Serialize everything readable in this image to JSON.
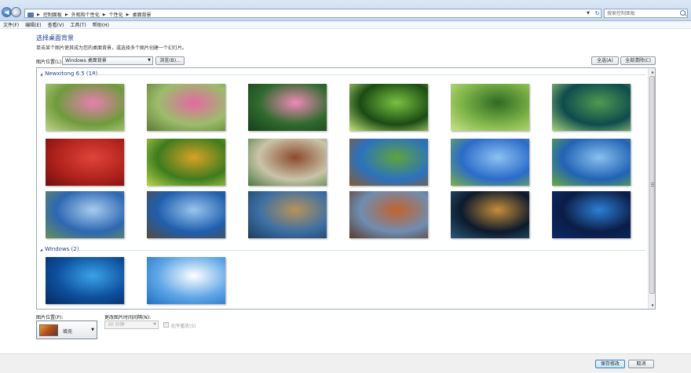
{
  "nav": {
    "back_glyph": "◀",
    "forward_glyph": "▶"
  },
  "address": {
    "crumbs": [
      "控制面板",
      "外观和个性化",
      "个性化",
      "桌面背景"
    ]
  },
  "search": {
    "placeholder": "搜索控制面板"
  },
  "menu": [
    "文件(F)",
    "编辑(E)",
    "查看(V)",
    "工具(T)",
    "帮助(H)"
  ],
  "page": {
    "title": "选择桌面背景",
    "description": "单击某个图片使其成为您的桌面背景，或选择多个图片创建一个幻灯片。",
    "location_label": "图片位置(L):",
    "location_value": "Windows 桌面背景",
    "browse_label": "浏览(B)...",
    "select_all_label": "全选(A)",
    "clear_all_label": "全部清除(C)"
  },
  "groups": [
    {
      "title": "Newxitong 6.5 (18)"
    },
    {
      "title": "Windows (2)"
    }
  ],
  "thumbnails": [
    [
      "#6f9b3c",
      "#e77fb1",
      "#c0d48a"
    ],
    [
      "#9bbd6a",
      "#e46aa3",
      "#5d7a36"
    ],
    [
      "#2f6a2d",
      "#f089b8",
      "#163e1c"
    ],
    [
      "#1a4b13",
      "#7ac142",
      "#c8e57f"
    ],
    [
      "#7fb54a",
      "#2e6a22",
      "#cbe28b"
    ],
    [
      "#0e4b4e",
      "#4f9a4f",
      "#a9d67e"
    ],
    [
      "#b0221d",
      "#e0443a",
      "#6f0f0d"
    ],
    [
      "#3e7b1f",
      "#d9a223",
      "#b9d54b"
    ],
    [
      "#c9c4a9",
      "#8d4a2d",
      "#4c7a41"
    ],
    [
      "#2b72be",
      "#5fa33e",
      "#8a5b33"
    ],
    [
      "#2b6bc9",
      "#8cc2f0",
      "#7bb143"
    ],
    [
      "#2163b5",
      "#89c0ee",
      "#6aaa3f"
    ],
    [
      "#2d67b2",
      "#a8cdef",
      "#6b8f57"
    ],
    [
      "#1f5fae",
      "#9ac5ee",
      "#574a3f"
    ],
    [
      "#3c6fa4",
      "#b7935a",
      "#1e3c5c"
    ],
    [
      "#6f8db2",
      "#c2632c",
      "#5a3b2a"
    ],
    [
      "#0c1a2c",
      "#c68d3a",
      "#2a5a7a"
    ],
    [
      "#0b1d45",
      "#2c7fd6",
      "#0a2a6b"
    ],
    [
      "#0d4f9c",
      "#3aa3e8",
      "#062a5e"
    ],
    [
      "#5fa6e6",
      "#ffffff",
      "#1f6fc2"
    ]
  ],
  "bottom": {
    "position_label": "图片位置(P):",
    "position_value": "填充",
    "interval_label": "更改图片时间间隔(N):",
    "interval_value": "30 分钟",
    "shuffle_label": "无序播放(S)"
  },
  "footer": {
    "save_label": "保存修改",
    "cancel_label": "取消"
  }
}
